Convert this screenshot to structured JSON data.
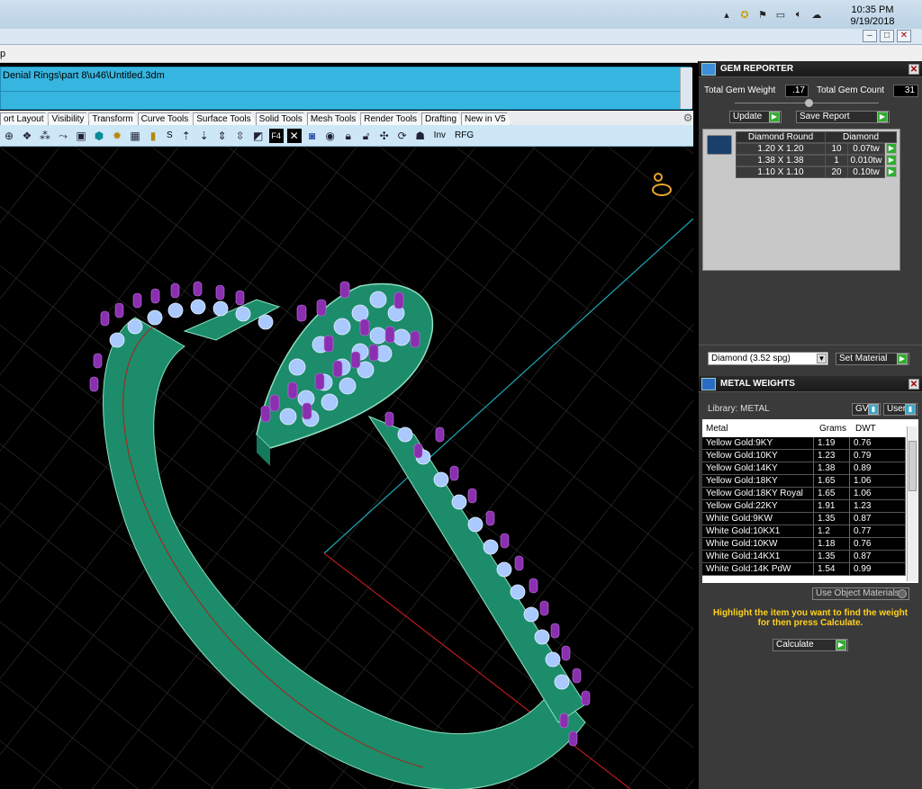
{
  "taskbar": {
    "time": "10:35 PM",
    "date": "9/19/2018",
    "icons": [
      "chevron-up-icon",
      "network-icon",
      "flag-icon",
      "monitor-icon",
      "speaker-icon",
      "cloud-icon"
    ]
  },
  "window": {
    "controls": [
      "–",
      "□",
      "✕"
    ]
  },
  "menu": {
    "partial_item": "p"
  },
  "command": {
    "path": "Denial Rings\\part 8\\u46\\Untitled.3dm"
  },
  "tabs": [
    "ort Layout",
    "Visibility",
    "Transform",
    "Curve Tools",
    "Surface Tools",
    "Solid Tools",
    "Mesh Tools",
    "Render Tools",
    "Drafting",
    "New in V5"
  ],
  "toolbar": {
    "text_s": "S",
    "text_inv": "Inv",
    "text_rfg": "RFG"
  },
  "gem_reporter": {
    "title": "GEM REPORTER",
    "total_weight_label": "Total Gem Weight",
    "total_weight_value": ".17",
    "total_count_label": "Total Gem Count",
    "total_count_value": "31",
    "update_label": "Update",
    "save_label": "Save Report",
    "table_headers": [
      "Diamond Round",
      "Diamond"
    ],
    "rows": [
      {
        "size": "1.20 X 1.20",
        "count": "10",
        "weight": "0.07tw"
      },
      {
        "size": "1.38 X 1.38",
        "count": "1",
        "weight": "0.010tw"
      },
      {
        "size": "1.10 X 1.10",
        "count": "20",
        "weight": "0.10tw"
      }
    ],
    "material_value": "Diamond      (3.52 spg)",
    "set_material_label": "Set Material"
  },
  "metal_weights": {
    "title": "METAL WEIGHTS",
    "library_label": "Library: METAL",
    "gv_label": "GV",
    "user_label": "User",
    "headers": [
      "Metal",
      "Grams",
      "DWT"
    ],
    "rows": [
      {
        "metal": "Yellow Gold:9KY",
        "grams": "1.19",
        "dwt": "0.76"
      },
      {
        "metal": "Yellow Gold:10KY",
        "grams": "1.23",
        "dwt": "0.79"
      },
      {
        "metal": "Yellow Gold:14KY",
        "grams": "1.38",
        "dwt": "0.89"
      },
      {
        "metal": "Yellow Gold:18KY",
        "grams": "1.65",
        "dwt": "1.06"
      },
      {
        "metal": "Yellow Gold:18KY Royal",
        "grams": "1.65",
        "dwt": "1.06"
      },
      {
        "metal": "Yellow Gold:22KY",
        "grams": "1.91",
        "dwt": "1.23"
      },
      {
        "metal": "White Gold:9KW",
        "grams": "1.35",
        "dwt": "0.87"
      },
      {
        "metal": "White Gold:10KX1",
        "grams": "1.2",
        "dwt": "0.77"
      },
      {
        "metal": "White Gold:10KW",
        "grams": "1.18",
        "dwt": "0.76"
      },
      {
        "metal": "White Gold:14KX1",
        "grams": "1.35",
        "dwt": "0.87"
      },
      {
        "metal": "White Gold:14K PdW",
        "grams": "1.54",
        "dwt": "0.99"
      }
    ],
    "use_object_label": "Use Object Materials",
    "hint": "Highlight the item you want to find the weight for then press Calculate.",
    "calculate_label": "Calculate"
  },
  "colors": {
    "accent_green": "#2fae2f",
    "ring_green": "#1c8c6a",
    "prong_purple": "#8a2fb0",
    "gem_blue": "#a9c9ff",
    "command_blue": "#36b5e0",
    "hint_yellow": "#ffd21e"
  }
}
